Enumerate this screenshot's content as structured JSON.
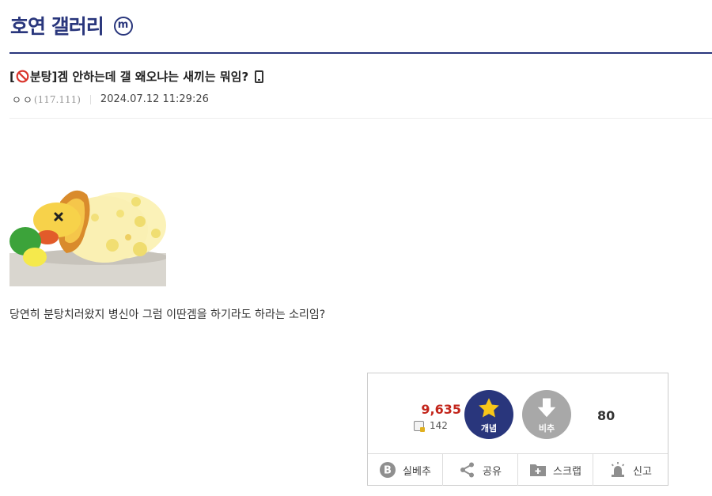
{
  "gallery": {
    "title": "호연 갤러리",
    "badge_letter": "m",
    "badge_icon": "minor-gallery-icon"
  },
  "post": {
    "title_prefix": "[",
    "title_head": "분탕]",
    "title_main": " 겜 안하는데 갤 왜오냐는 새끼는 뭐임?",
    "writer_nick": "ㅇㅇ",
    "writer_ip": "(117.111)",
    "date": "2024.07.12 11:29:26",
    "body": "당연히 분탕치러왔지 병신아 그럼 이딴겜을 하기라도 하라는 소리임?"
  },
  "recommend": {
    "up_count": "9,635",
    "fix_count": "142",
    "up_label": "개념",
    "down_label": "비추",
    "down_count": "80"
  },
  "actions": [
    {
      "label": "실베추",
      "icon": "best-b-icon"
    },
    {
      "label": "공유",
      "icon": "share-icon"
    },
    {
      "label": "스크랩",
      "icon": "scrap-folder-icon"
    },
    {
      "label": "신고",
      "icon": "report-siren-icon"
    }
  ],
  "colors": {
    "brand": "#29367c",
    "up_count": "#c3261c",
    "down_button": "#a8a8a8"
  }
}
